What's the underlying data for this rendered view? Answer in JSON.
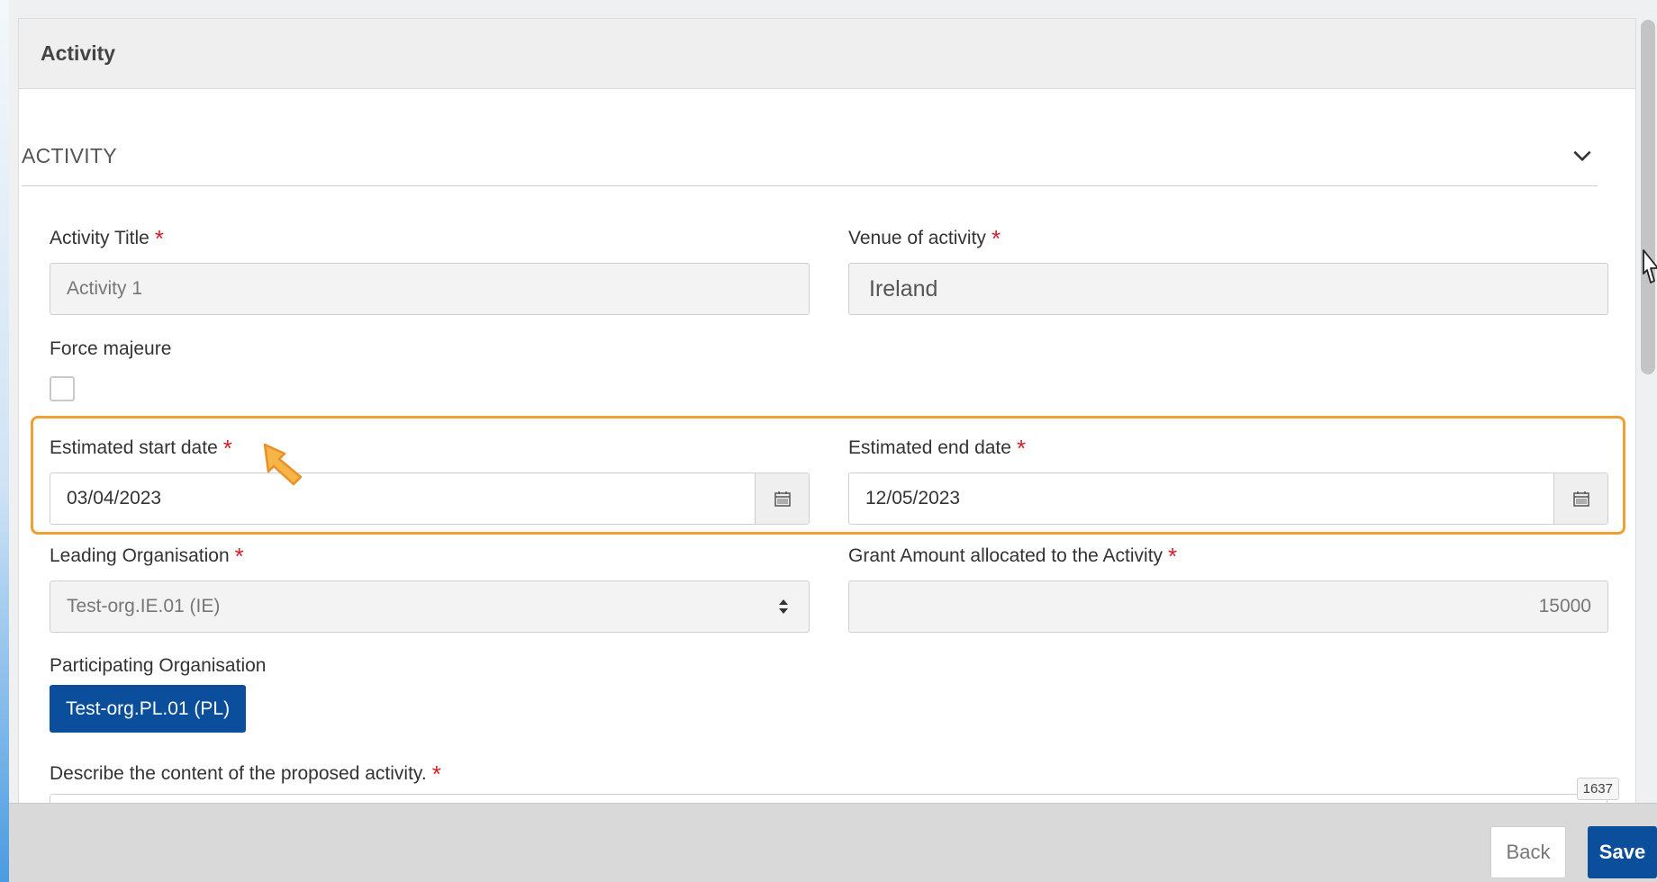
{
  "panel": {
    "title": "Activity"
  },
  "section": {
    "title": "ACTIVITY"
  },
  "fields": {
    "activity_title": {
      "label": "Activity Title",
      "value": "Activity 1"
    },
    "venue": {
      "label": "Venue of activity",
      "value": "Ireland"
    },
    "force_majeure": {
      "label": "Force majeure",
      "checked": false
    },
    "start_date": {
      "label": "Estimated start date",
      "value": "03/04/2023"
    },
    "end_date": {
      "label": "Estimated end date",
      "value": "12/05/2023"
    },
    "leading_org": {
      "label": "Leading Organisation",
      "value": "Test-org.IE.01 (IE)"
    },
    "grant_amount": {
      "label": "Grant Amount allocated to the Activity",
      "value": "15000"
    },
    "participating_org": {
      "label": "Participating Organisation",
      "tag": "Test-org.PL.01 (PL)"
    },
    "description": {
      "label": "Describe the content of the proposed activity.",
      "char_count": "1637"
    }
  },
  "required_mark": "*",
  "footer": {
    "back_label": "Back",
    "save_label": "Save"
  },
  "colors": {
    "primary": "#0b4e9b",
    "highlight": "#f0a033",
    "required": "#d0202e"
  }
}
